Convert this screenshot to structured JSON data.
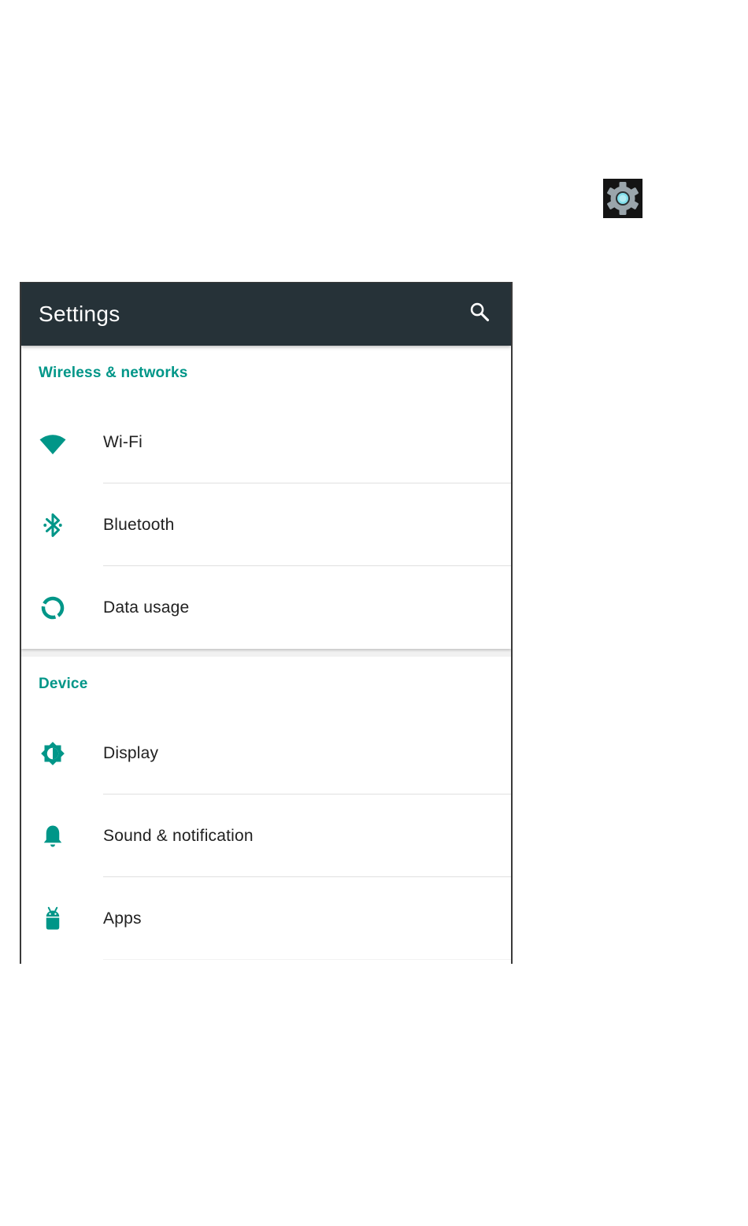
{
  "appbar": {
    "title": "Settings"
  },
  "sections": [
    {
      "header": "Wireless & networks",
      "items": [
        {
          "label": "Wi-Fi",
          "icon": "wifi-icon"
        },
        {
          "label": "Bluetooth",
          "icon": "bluetooth-icon"
        },
        {
          "label": "Data usage",
          "icon": "data-usage-icon"
        }
      ]
    },
    {
      "header": "Device",
      "items": [
        {
          "label": "Display",
          "icon": "display-icon"
        },
        {
          "label": "Sound & notification",
          "icon": "bell-icon"
        },
        {
          "label": "Apps",
          "icon": "android-icon"
        }
      ]
    }
  ],
  "colors": {
    "appbar": "#263238",
    "accent": "#009688",
    "text": "#212121",
    "app_icon_gear": "#9aa5ab",
    "app_icon_center": "#80deea"
  },
  "icons": {
    "app": "settings-gear-icon",
    "search": "search-icon"
  }
}
